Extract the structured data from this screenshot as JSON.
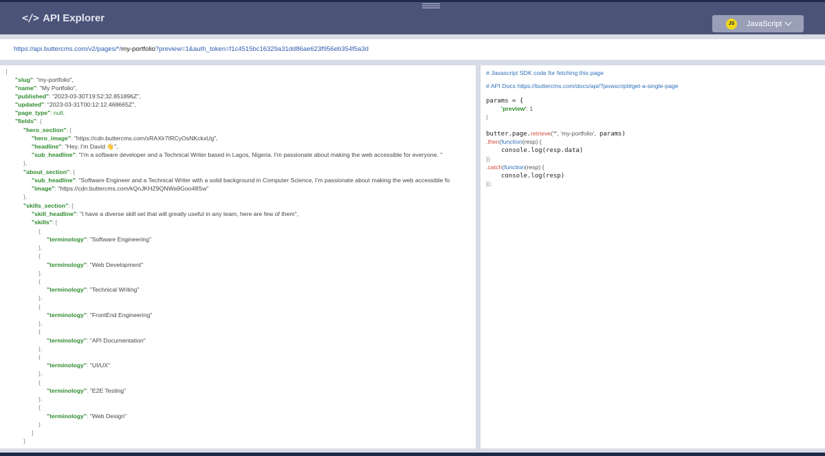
{
  "header": {
    "title": "API Explorer",
    "language": "JavaScript",
    "language_badge": "JS"
  },
  "url": {
    "base": "https://api.buttercms.com/v2/pages/*/",
    "slug": "my-portfolio",
    "query": "?preview=1&auth_token=f1c4515bc16329a31dd86ae623f956eb354f5a3d"
  },
  "response": {
    "slug": "\"my-portfolio\",",
    "name": "\"My Portfolio\",",
    "published": "\"2023-03-30T19:52:32.851896Z\",",
    "updated": "\"2023-03-31T00:12:12.468665Z\",",
    "page_type": "null,",
    "hero_image": "\"https://cdn.buttercms.com/xRAXlr7IRCyOsNKckxUg\",",
    "hero_headline": "\"Hey, I'm David 👋\",",
    "hero_sub_headline": "\"I'm a software developer and a Technical Writer based in Lagos, Nigeria. I'm passionate about making the web accessible for everyone. \"",
    "about_sub_headline": "\"Software Engineer and a Technical Writer with a solid background in Computer Science, I'm passionate about making the web accessible fo",
    "about_image": "\"https://cdn.buttercms.com/kQnJKHZ9QNWa9Goo48Sw\"",
    "skill_headline": "\"I have a diverse skill set that will greatly useful in any team, here are few of them\",",
    "skills": [
      "\"Software Engineering\"",
      "\"Web Development\"",
      "\"Technical Writing\"",
      "\"FrontEnd Engineering\"",
      "\"API Documentation\"",
      "\"UI/UX\"",
      "\"E2E Testing\"",
      "\"Web Design\""
    ]
  },
  "code": {
    "comment1": "# Javascript SDK code for fetching this page",
    "comment2": "# API Docs https://buttercms.com/docs/api/?javascript#get-a-single-page",
    "params_open": "params = {",
    "preview_key": "'preview'",
    "preview_val": ": 1",
    "close_brace": "}",
    "retrieve_obj": "butter.page.",
    "retrieve_fn": "retrieve",
    "retrieve_args": "('*',  'my-portfolio',",
    "retrieve_params": " params)",
    "then_fn": ".then",
    "then_kw": "(function",
    "then_rest": "(resp)  {",
    "console_data": "console.log",
    "resp_data": "(resp.data)",
    "close1": "})",
    "catch_fn": ".catch",
    "catch_kw": "(function",
    "catch_rest": "(resp)  {",
    "console_resp": "console.log",
    "resp_arg": "(resp)",
    "close2": "});"
  }
}
